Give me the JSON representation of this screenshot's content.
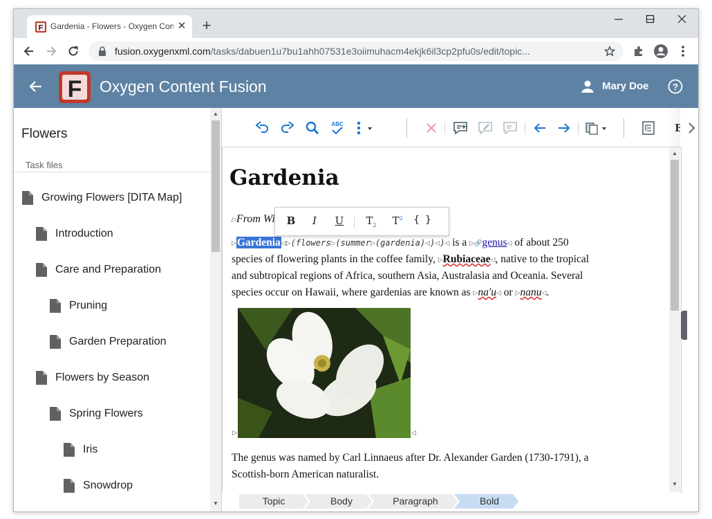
{
  "browser": {
    "tab_title": "Gardenia - Flowers - Oxygen Content Fusion",
    "url_host": "fusion.oxygenxml.com",
    "url_path": "/tasks/dabuen1u7bu1ahh07531e3oiimuhacm4ekjk6il3cp2pfu0s/edit/topic..."
  },
  "app": {
    "title": "Oxygen Content Fusion",
    "logo_letter": "F",
    "user_name": "Mary Doe"
  },
  "sidebar": {
    "title": "Flowers",
    "section_label": "Task files",
    "items": [
      {
        "label": "Growing Flowers [DITA Map]"
      },
      {
        "label": "Introduction"
      },
      {
        "label": "Care and Preparation"
      },
      {
        "label": "Pruning"
      },
      {
        "label": "Garden Preparation"
      },
      {
        "label": "Flowers by Season"
      },
      {
        "label": "Spring Flowers"
      },
      {
        "label": "Iris"
      },
      {
        "label": "Snowdrop"
      }
    ]
  },
  "editor": {
    "heading": "Gardenia",
    "from_text": "From Wiki",
    "p1_selected": "Gardenia",
    "p1_latin": "(flowers",
    "p1_latin2": "(summer",
    "p1_latin3": "(gardenia)",
    "p1_latin4": ")",
    "p1_latin5": ")",
    "p1_isa": "is a",
    "p1_genus": "genus",
    "p1_rest1": "of about 250",
    "p1_line2a": "species of flowering plants in the coffee family,",
    "p1_rubiaceae": "Rubiaceae",
    "p1_line2b": ", native to the tropical",
    "p1_line3": "and subtropical regions of Africa, southern Asia, Australasia and Oceania. Several",
    "p1_line4a": "species occur on Hawaii, where gardenias are known as",
    "p1_naau": "na'u",
    "p1_or": "or",
    "p1_nanu": "nanu",
    "p1_end": ".",
    "p2_line1": "The genus was named by Carl Linnaeus after Dr. Alexander Garden (1730-1791), a",
    "p2_line2": "Scottish-born American naturalist."
  },
  "format_bar": {
    "bold": "B",
    "italic": "I",
    "underline": "U",
    "subscript": "T",
    "subscript_mark": "2",
    "superscript": "T",
    "superscript_mark": "2",
    "code": "{ }"
  },
  "breadcrumb": [
    "Topic",
    "Body",
    "Paragraph",
    "Bold"
  ],
  "colors": {
    "header": "#5e82a3",
    "accent": "#3875d7",
    "toolbar_icon": "#1976d2"
  }
}
